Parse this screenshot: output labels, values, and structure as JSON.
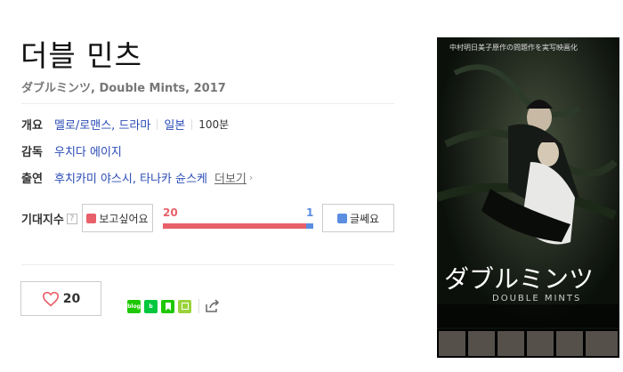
{
  "movie": {
    "title": "더블 민츠",
    "subtitle": "ダブルミンツ, Double Mints, 2017"
  },
  "info": {
    "overview_label": "개요",
    "genre": "멜로/로맨스, 드라마",
    "country": "일본",
    "runtime": "100분",
    "director_label": "감독",
    "director": "우치다 에이지",
    "cast_label": "출연",
    "cast": "후치카미 야스시, 타나카 슌스케",
    "more_label": "더보기"
  },
  "expectation": {
    "label": "기대지수",
    "help": "?",
    "want_label": "보고싶어요",
    "want_count": "20",
    "dislike_label": "글쎄요",
    "dislike_count": "1",
    "want_ratio": 0.952
  },
  "social": {
    "like_count": "20",
    "share_icons": [
      "blog-icon",
      "band-icon",
      "bookmark-icon",
      "memo-icon",
      "share-icon"
    ]
  },
  "poster": {
    "top_text": "中村明日美子原作の問題作を実写映画化",
    "title_jp": "ダブルミンツ",
    "title_en": "DOUBLE MINTS"
  },
  "colors": {
    "accent_red": "#e8606a",
    "accent_blue": "#5b8de0",
    "link": "#2a4bb5"
  }
}
